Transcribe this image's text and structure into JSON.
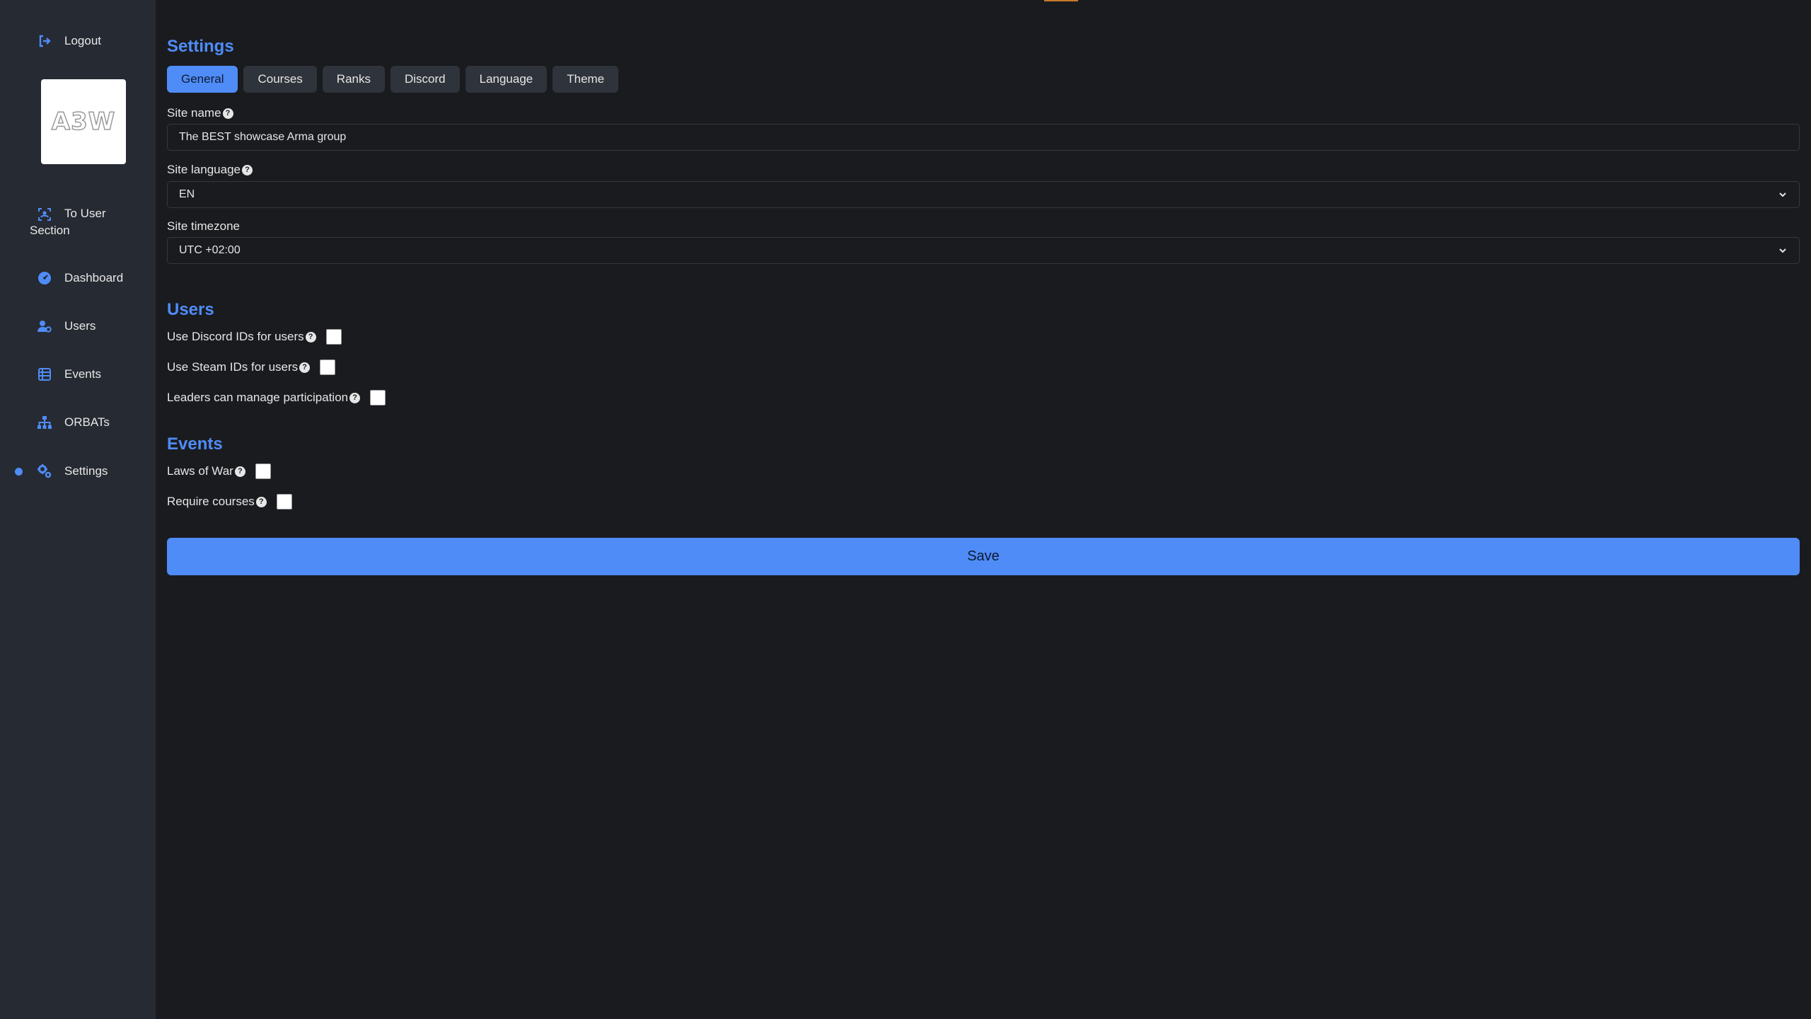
{
  "sidebar": {
    "logout": "Logout",
    "logo_text": "A3W",
    "to_user_section": [
      "To User",
      "Section"
    ],
    "items": [
      {
        "label": "Dashboard",
        "icon": "dashboard-icon"
      },
      {
        "label": "Users",
        "icon": "users-cog-icon"
      },
      {
        "label": "Events",
        "icon": "table-list-icon"
      },
      {
        "label": "ORBATs",
        "icon": "sitemap-icon"
      },
      {
        "label": "Settings",
        "icon": "gears-icon",
        "active": true
      }
    ]
  },
  "settings": {
    "title": "Settings",
    "tabs": [
      "General",
      "Courses",
      "Ranks",
      "Discord",
      "Language",
      "Theme"
    ],
    "active_tab": "General",
    "site_name_label": "Site name",
    "site_name_value": "The BEST showcase Arma group",
    "site_language_label": "Site language",
    "site_language_value": "EN",
    "site_timezone_label": "Site timezone",
    "site_timezone_value": "UTC +02:00"
  },
  "users": {
    "title": "Users",
    "discord_ids_label": "Use Discord IDs for users",
    "steam_ids_label": "Use Steam IDs for users",
    "leaders_manage_label": "Leaders can manage participation"
  },
  "events": {
    "title": "Events",
    "laws_of_war_label": "Laws of War",
    "require_courses_label": "Require courses"
  },
  "save_label": "Save",
  "colors": {
    "accent": "#4f8cf7",
    "sidebar_bg": "#262a32",
    "main_bg": "#1a1b1f"
  }
}
